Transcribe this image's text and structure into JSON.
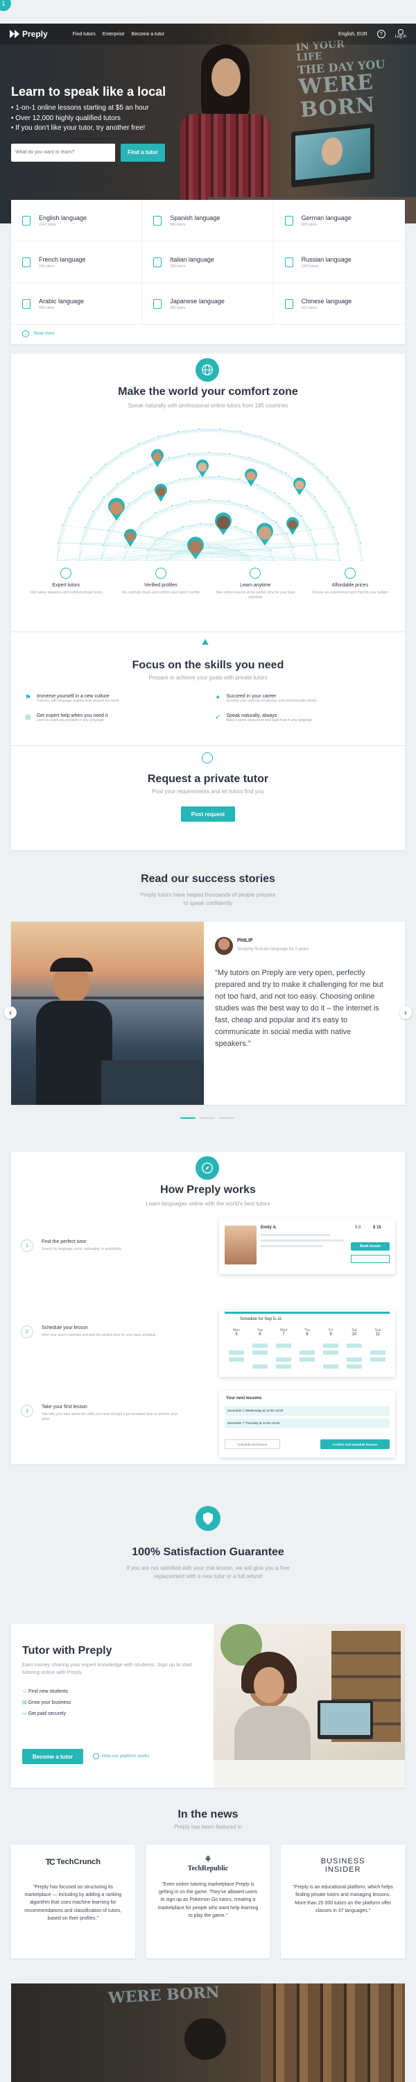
{
  "top_badge": "1",
  "header": {
    "logo": "Preply",
    "nav": [
      "Find tutors",
      "Enterprise",
      "Become a tutor"
    ],
    "language": "English, EUR",
    "help": "?",
    "login": "Log in"
  },
  "hero": {
    "title": "Learn to speak like a local",
    "bullets": [
      "1-on-1 online lessons starting at $5 an hour",
      "Over 12,000 highly qualified tutors",
      "If you don't like your tutor, try another free!"
    ],
    "search_placeholder": "What do you want to learn?",
    "cta": "Find a tutor",
    "wall_text": [
      "IN YOUR",
      "LIFE",
      "THE DAY YOU",
      "WERE BORN"
    ]
  },
  "languages": [
    {
      "name": "English language",
      "count": "2047 tutors"
    },
    {
      "name": "Spanish language",
      "count": "983 tutors"
    },
    {
      "name": "German language",
      "count": "805 tutors"
    },
    {
      "name": "French language",
      "count": "550 tutors"
    },
    {
      "name": "Italian language",
      "count": "289 tutors"
    },
    {
      "name": "Russian language",
      "count": "1903 tutors"
    },
    {
      "name": "Arabic language",
      "count": "409 tutors"
    },
    {
      "name": "Japanese language",
      "count": "303 tutors"
    },
    {
      "name": "Chinese language",
      "count": "416 tutors"
    }
  ],
  "show_more": "Show more",
  "comfort": {
    "title": "Make the world your comfort zone",
    "subtitle": "Speak naturally with professional online tutors from 185 countries",
    "features": [
      {
        "title": "Expert tutors",
        "desc": "Find native speakers and certified private tutors"
      },
      {
        "title": "Verified profiles",
        "desc": "We carefully check and confirm each tutor's profile"
      },
      {
        "title": "Learn anytime",
        "desc": "Take online lessons at the perfect time for your busy schedule"
      },
      {
        "title": "Affordable prices",
        "desc": "Choose an experienced tutor that fits your budget"
      }
    ]
  },
  "skills": {
    "title": "Focus on the skills you need",
    "subtitle": "Prepare to achieve your goals with private tutors",
    "items": [
      {
        "title": "Immerse yourself in a new culture",
        "desc": "Connect with language experts from around the world"
      },
      {
        "title": "Succeed in your career",
        "desc": "Develop your working vocabulary and communicate clearly"
      },
      {
        "title": "Get expert help when you need it",
        "desc": "Learn to solve any problem in any language"
      },
      {
        "title": "Speak naturally, always",
        "desc": "Make a good impression and build trust in any language"
      }
    ]
  },
  "request": {
    "title": "Request a private tutor",
    "subtitle": "Post your requirements and let tutors find you",
    "button": "Post request"
  },
  "stories": {
    "title": "Read our success stories",
    "subtitle": "Preply tutors have helped thousands of people prepare to speak confidently",
    "name": "PHILIP",
    "meta": "Studying Russian language for 2 years",
    "quote": "\"My tutors on Preply are very open, perfectly prepared and try to make it challenging for me but not too hard, and not too easy. Choosing online studies was the best way to do it – the internet is fast, cheap and popular and it's easy to communicate in social media with native speakers.\"",
    "prev": "‹",
    "next": "›"
  },
  "how": {
    "title": "How Preply works",
    "subtitle": "Learn languages online with the world's best tutors",
    "steps": [
      {
        "num": "1",
        "title": "Find the perfect tutor",
        "desc": "Search by language, price, nationality, or availability"
      },
      {
        "num": "2",
        "title": "Schedule your lesson",
        "desc": "View your tutor's calendar and pick the perfect time for your busy schedule"
      },
      {
        "num": "3",
        "title": "Take your first lesson",
        "desc": "Talk with your tutor about the skills you need and get a personalized plan to achieve your goals"
      }
    ],
    "mock1": {
      "name": "Emily A.",
      "price": "$ 15",
      "rating": "5.0",
      "btn": "Book lesson"
    },
    "mock2": {
      "title": "Schedule for Sep 5–11",
      "days": [
        "Mon",
        "Tue",
        "Wed",
        "Thu",
        "Fri",
        "Sat",
        "Sun"
      ],
      "dates": [
        "5",
        "6",
        "7",
        "8",
        "9",
        "10",
        "11"
      ]
    },
    "mock3": {
      "title": "Your next lessons",
      "row1": "December 1 Wednesday at 11:00–12:00",
      "row2": "December 7 Thursday at 11:00–12:00",
      "btn1": "Schedule next lesson",
      "btn2": "Confirm and schedule lessons"
    }
  },
  "guarantee": {
    "title": "100% Satisfaction Guarantee",
    "subtitle": "If you are not satisfied with your trial lesson, we will give you a free replacement with a new tutor or a full refund"
  },
  "tutor_with": {
    "title": "Tutor with Preply",
    "desc": "Earn money sharing your expert knowledge with students. Sign up to start tutoring online with Preply.",
    "items": [
      "Find new students",
      "Grow your business",
      "Get paid securely"
    ],
    "button": "Become a tutor",
    "link": "How our platform works"
  },
  "news": {
    "title": "In the news",
    "subtitle": "Preply has been featured in",
    "items": [
      {
        "logo": "TechCrunch",
        "quote": "\"Preply has focused on structuring its marketplace — including by adding a ranking algorithm that uses machine learning for recommendations and classification of tutors, based on their profiles.\""
      },
      {
        "logo": "TechRepublic",
        "quote": "\"Even online tutoring marketplace Preply is getting in on the game. They've allowed users to sign up as Pokemon Go tutors, creating a marketplace for people who want help learning to play the game.\""
      },
      {
        "logo": "BUSINESS INSIDER",
        "quote": "\"Preply is an educational platform, which helps finding private tutors and managing lessons. More than 25 000 tutors on the platform offer classes in 37 languages.\""
      }
    ]
  },
  "colors": {
    "accent": "#27b5b6",
    "dark": "#2b3240"
  }
}
